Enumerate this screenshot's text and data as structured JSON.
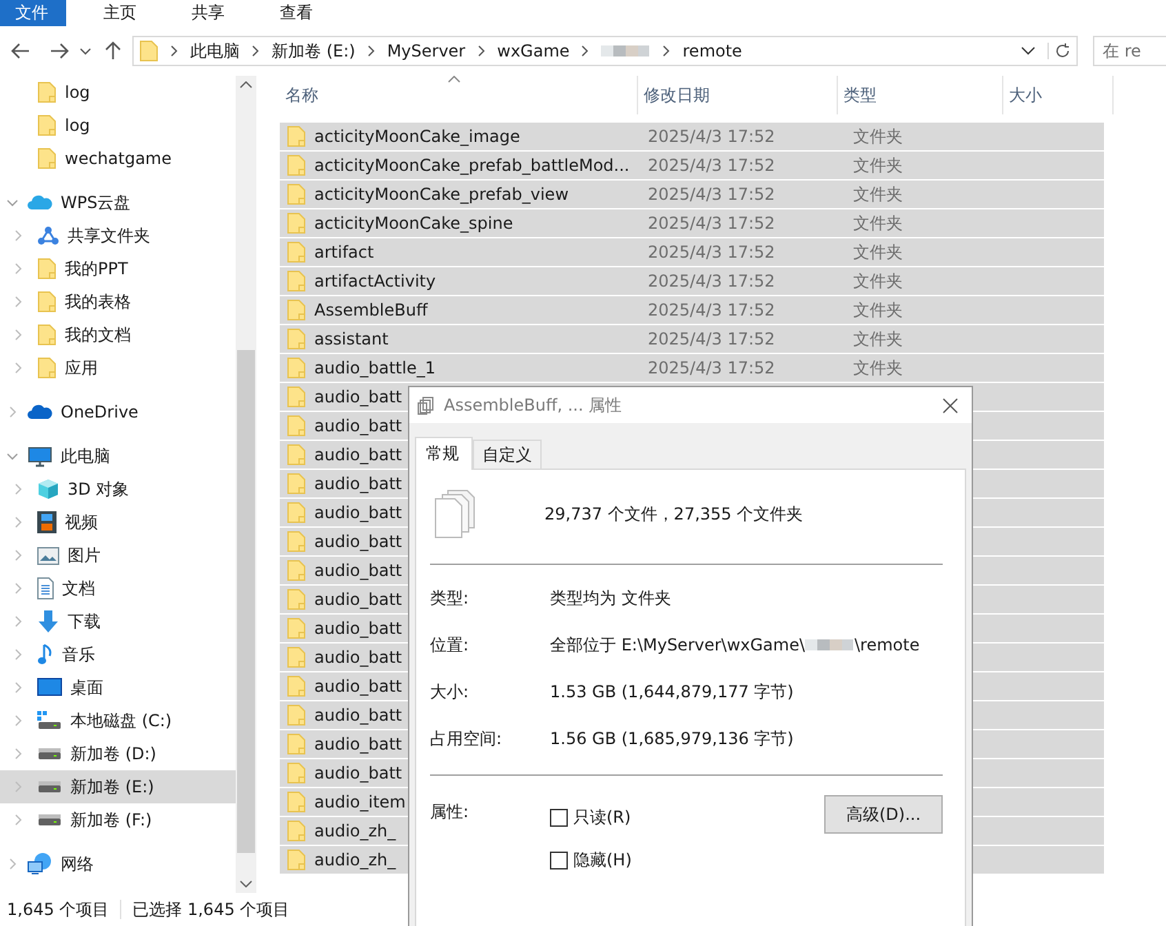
{
  "ribbon": {
    "tabs": [
      {
        "label": "文件",
        "selected": true
      },
      {
        "label": "主页",
        "selected": false
      },
      {
        "label": "共享",
        "selected": false
      },
      {
        "label": "查看",
        "selected": false
      }
    ]
  },
  "address_bar": {
    "crumbs_before": [
      "此电脑",
      "新加卷 (E:)",
      "MyServer",
      "wxGame"
    ],
    "crumbs_after": [
      "remote"
    ]
  },
  "search": {
    "placeholder": "在 re"
  },
  "sidebar": {
    "partial_items": [
      {
        "label": "log",
        "kind": "folder",
        "selected": false
      },
      {
        "label": "log",
        "kind": "folder",
        "selected": false
      },
      {
        "label": "wechatgame",
        "kind": "folder",
        "selected": false
      }
    ],
    "items": [
      {
        "label": "WPS云盘",
        "kind": "cloud",
        "expanded": true,
        "selected": false,
        "children": [
          {
            "label": "共享文件夹",
            "kind": "share",
            "expanded": false,
            "selected": false
          },
          {
            "label": "我的PPT",
            "kind": "folder",
            "expanded": false,
            "selected": false
          },
          {
            "label": "我的表格",
            "kind": "folder",
            "expanded": false,
            "selected": false
          },
          {
            "label": "我的文档",
            "kind": "folder",
            "expanded": false,
            "selected": false
          },
          {
            "label": "应用",
            "kind": "folder",
            "expanded": false,
            "selected": false
          }
        ]
      },
      {
        "label": "OneDrive",
        "kind": "onedrive",
        "expanded": false,
        "selected": false
      },
      {
        "label": "此电脑",
        "kind": "pc",
        "expanded": true,
        "selected": false,
        "children": [
          {
            "label": "3D 对象",
            "kind": "cube",
            "expanded": false,
            "selected": false
          },
          {
            "label": "视频",
            "kind": "video",
            "expanded": false,
            "selected": false
          },
          {
            "label": "图片",
            "kind": "image",
            "expanded": false,
            "selected": false
          },
          {
            "label": "文档",
            "kind": "doc",
            "expanded": false,
            "selected": false
          },
          {
            "label": "下载",
            "kind": "download",
            "expanded": false,
            "selected": false
          },
          {
            "label": "音乐",
            "kind": "music",
            "expanded": false,
            "selected": false
          },
          {
            "label": "桌面",
            "kind": "desktop",
            "expanded": false,
            "selected": false
          },
          {
            "label": "本地磁盘 (C:)",
            "kind": "windrive",
            "expanded": false,
            "selected": false
          },
          {
            "label": "新加卷 (D:)",
            "kind": "drive",
            "expanded": false,
            "selected": false
          },
          {
            "label": "新加卷 (E:)",
            "kind": "drive",
            "expanded": false,
            "selected": true
          },
          {
            "label": "新加卷 (F:)",
            "kind": "drive",
            "expanded": false,
            "selected": false
          }
        ]
      },
      {
        "label": "网络",
        "kind": "network",
        "expanded": false,
        "selected": false
      }
    ]
  },
  "table": {
    "columns": [
      "名称",
      "修改日期",
      "类型",
      "大小"
    ],
    "rows": [
      {
        "name": "acticityMoonCake_image",
        "date": "2025/4/3 17:52",
        "type": "文件夹",
        "selected": true
      },
      {
        "name": "acticityMoonCake_prefab_battleMod...",
        "date": "2025/4/3 17:52",
        "type": "文件夹",
        "selected": true
      },
      {
        "name": "acticityMoonCake_prefab_view",
        "date": "2025/4/3 17:52",
        "type": "文件夹",
        "selected": true
      },
      {
        "name": "acticityMoonCake_spine",
        "date": "2025/4/3 17:52",
        "type": "文件夹",
        "selected": true
      },
      {
        "name": "artifact",
        "date": "2025/4/3 17:52",
        "type": "文件夹",
        "selected": true
      },
      {
        "name": "artifactActivity",
        "date": "2025/4/3 17:52",
        "type": "文件夹",
        "selected": true
      },
      {
        "name": "AssembleBuff",
        "date": "2025/4/3 17:52",
        "type": "文件夹",
        "selected": true
      },
      {
        "name": "assistant",
        "date": "2025/4/3 17:52",
        "type": "文件夹",
        "selected": true
      },
      {
        "name": "audio_battle_1",
        "date": "2025/4/3 17:52",
        "type": "文件夹",
        "selected": true
      },
      {
        "name": "audio_batt",
        "selected": true
      },
      {
        "name": "audio_batt",
        "selected": true
      },
      {
        "name": "audio_batt",
        "selected": true
      },
      {
        "name": "audio_batt",
        "selected": true
      },
      {
        "name": "audio_batt",
        "selected": true
      },
      {
        "name": "audio_batt",
        "selected": true
      },
      {
        "name": "audio_batt",
        "selected": true
      },
      {
        "name": "audio_batt",
        "selected": true
      },
      {
        "name": "audio_batt",
        "selected": true
      },
      {
        "name": "audio_batt",
        "selected": true
      },
      {
        "name": "audio_batt",
        "selected": true
      },
      {
        "name": "audio_batt",
        "selected": true
      },
      {
        "name": "audio_batt",
        "selected": true
      },
      {
        "name": "audio_batt",
        "selected": true
      },
      {
        "name": "audio_item",
        "selected": true
      },
      {
        "name": "audio_zh_",
        "selected": true
      },
      {
        "name": "audio_zh_",
        "selected": true
      }
    ]
  },
  "status_bar": {
    "item_count": "1,645 个项目",
    "selection": "已选择 1,645 个项目"
  },
  "dialog": {
    "title": "AssembleBuff, ... 属性",
    "tabs": [
      {
        "label": "常规",
        "selected": true
      },
      {
        "label": "自定义",
        "selected": false
      }
    ],
    "summary": "29,737 个文件，27,355 个文件夹",
    "fields": [
      {
        "label": "类型:",
        "value": "类型均为 文件夹"
      },
      {
        "label": "位置:",
        "value": "全部位于 E:\\MyServer\\wxGame\\",
        "value_after_blur": "\\remote"
      },
      {
        "label": "大小:",
        "value": "1.53 GB (1,644,879,177 字节)"
      },
      {
        "label": "占用空间:",
        "value": "1.56 GB (1,685,979,136 字节)"
      }
    ],
    "attributes_label": "属性:",
    "checkboxes": [
      {
        "label": "只读(R)",
        "checked": false
      },
      {
        "label": "隐藏(H)",
        "checked": false
      }
    ],
    "advanced_button": "高级(D)..."
  }
}
